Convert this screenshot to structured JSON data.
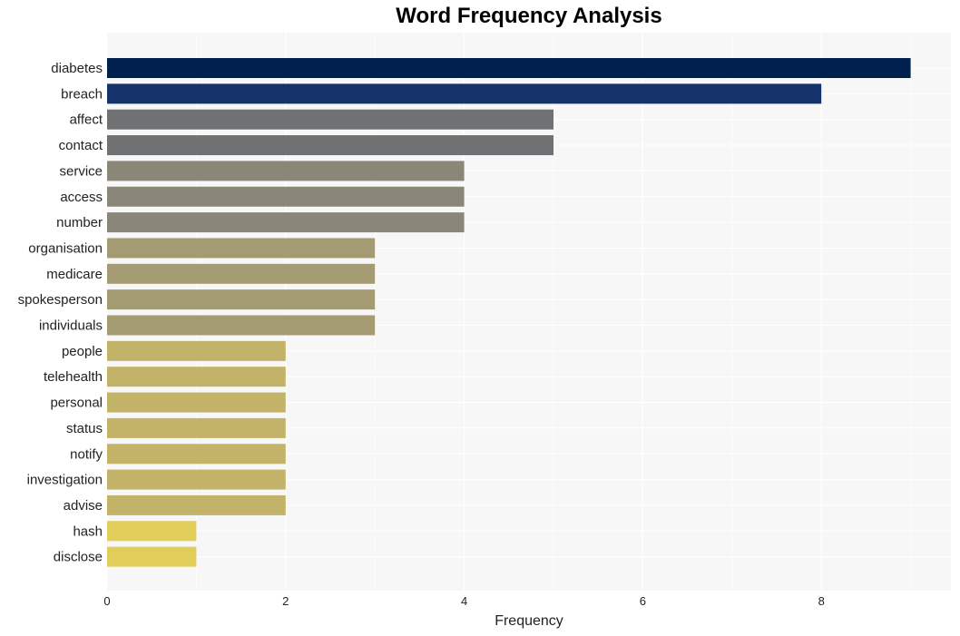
{
  "chart_data": {
    "type": "bar",
    "orientation": "horizontal",
    "title": "Word Frequency Analysis",
    "xlabel": "Frequency",
    "ylabel": "",
    "xlim": [
      0,
      9.5
    ],
    "xticks": [
      0,
      2,
      4,
      6,
      8
    ],
    "grid": true,
    "categories": [
      "diabetes",
      "breach",
      "affect",
      "contact",
      "service",
      "access",
      "number",
      "organisation",
      "medicare",
      "spokesperson",
      "individuals",
      "people",
      "telehealth",
      "personal",
      "status",
      "notify",
      "investigation",
      "advise",
      "hash",
      "disclose"
    ],
    "values": [
      9,
      8,
      5,
      5,
      4,
      4,
      4,
      3,
      3,
      3,
      3,
      2,
      2,
      2,
      2,
      2,
      2,
      2,
      1,
      1
    ],
    "colors": [
      "#00204e",
      "#14336b",
      "#707173",
      "#707173",
      "#8a8778",
      "#8a8778",
      "#8a8778",
      "#a59b73",
      "#a59b73",
      "#a59b73",
      "#a59b73",
      "#c3b369",
      "#c3b369",
      "#c3b369",
      "#c3b369",
      "#c3b369",
      "#c3b369",
      "#c3b369",
      "#e1cd5a",
      "#e1cd5a"
    ]
  }
}
